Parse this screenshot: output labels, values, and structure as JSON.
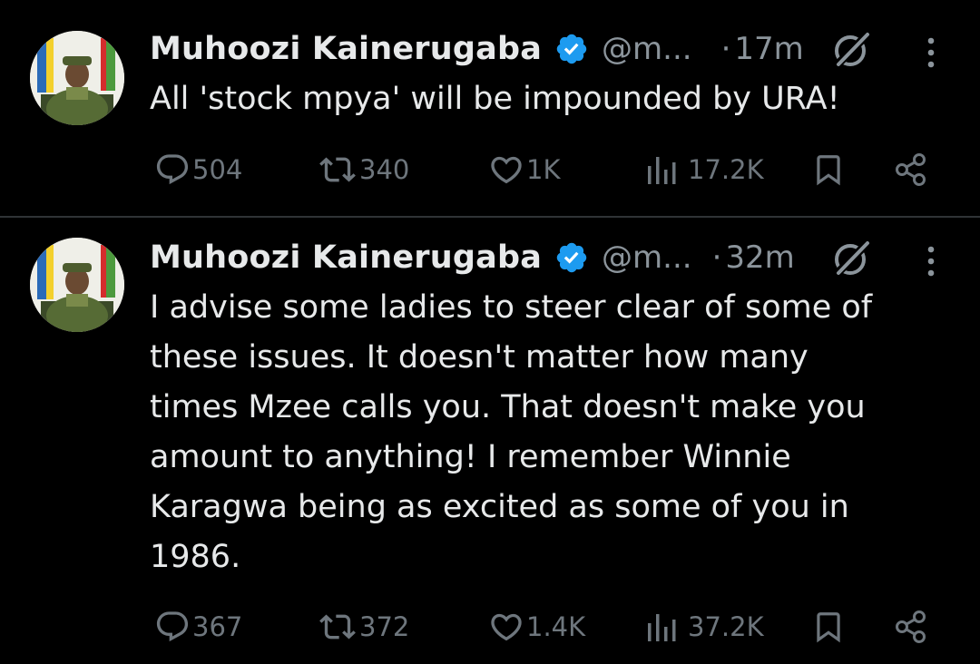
{
  "tweets": [
    {
      "author_name": "Muhoozi Kainerugaba",
      "handle": "@m...",
      "time": "17m",
      "separator": "·",
      "text": "All 'stock mpya' will be impounded by URA!",
      "replies": "504",
      "reposts": "340",
      "likes": "1K",
      "views": "17.2K"
    },
    {
      "author_name": "Muhoozi Kainerugaba",
      "handle": "@m...",
      "time": "32m",
      "separator": "·",
      "text": "I advise some ladies to steer clear of some of\nthese issues. It doesn't matter how many\ntimes Mzee calls you. That doesn't make you\namount to anything! I remember Winnie\nKaragwa being as excited as some of you in\n1986.",
      "replies": "367",
      "reposts": "372",
      "likes": "1.4K",
      "views": "37.2K"
    }
  ],
  "colors": {
    "background": "#000000",
    "text": "#e7e9ea",
    "muted": "#6e767d",
    "verified": "#1d9bf0",
    "divider": "#2f3336"
  },
  "icons": [
    "verified-badge-icon",
    "grok-icon",
    "more-icon",
    "reply-icon",
    "repost-icon",
    "like-icon",
    "views-icon",
    "bookmark-icon",
    "share-icon"
  ]
}
